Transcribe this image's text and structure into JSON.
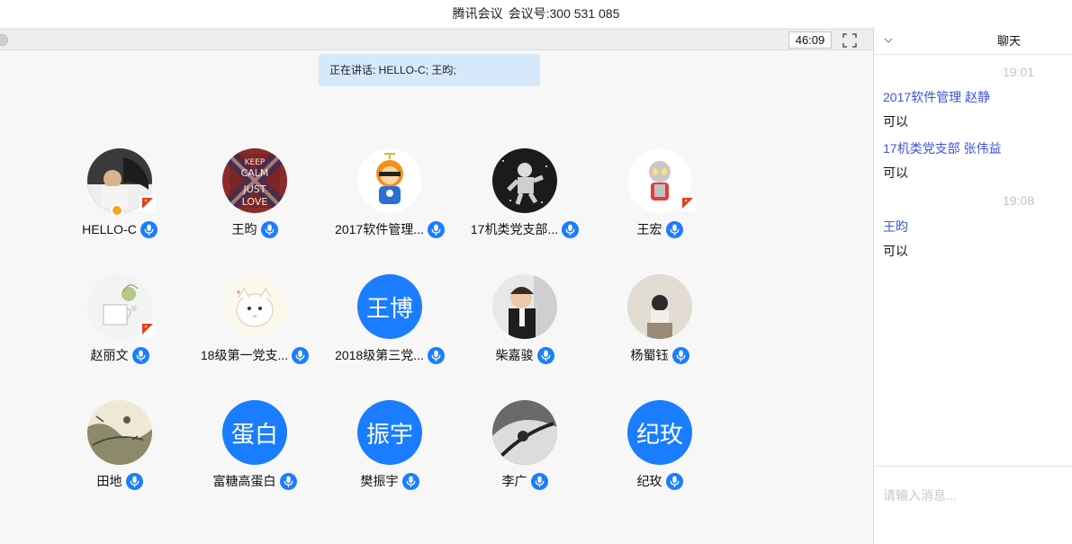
{
  "window": {
    "app_name": "腾讯会议",
    "meeting_id_label": "会议号:",
    "meeting_id": "300 531 085"
  },
  "toolbar": {
    "timer": "46:09",
    "fullscreen_icon": "fullscreen-icon"
  },
  "speaking": {
    "text": "正在讲话: HELLO-C; 王昀;"
  },
  "participants": [
    {
      "name": "HELLO-C",
      "avatar": "photo"
    },
    {
      "name": "王昀",
      "avatar": "photo"
    },
    {
      "name": "2017软件管理...",
      "avatar": "photo"
    },
    {
      "name": "17机类党支部...",
      "avatar": "photo"
    },
    {
      "name": "王宏",
      "avatar": "photo"
    },
    {
      "name": "赵丽文",
      "avatar": "photo"
    },
    {
      "name": "18级第一党支...",
      "avatar": "photo"
    },
    {
      "name": "2018级第三党...",
      "avatar": "text",
      "avatar_text": "王博"
    },
    {
      "name": "柴嘉骏",
      "avatar": "photo"
    },
    {
      "name": "杨蜀钰",
      "avatar": "photo"
    },
    {
      "name": "田地",
      "avatar": "photo"
    },
    {
      "name": "富糖高蛋白",
      "avatar": "text",
      "avatar_text": "蛋白"
    },
    {
      "name": "樊振宇",
      "avatar": "text",
      "avatar_text": "振宇"
    },
    {
      "name": "李广",
      "avatar": "photo"
    },
    {
      "name": "纪玫",
      "avatar": "text",
      "avatar_text": "纪玫"
    }
  ],
  "chat": {
    "title": "聊天",
    "collapse_icon": "chevron-down-icon",
    "messages": [
      {
        "time": "19:01",
        "sender": "2017软件管理 赵静",
        "text": "可以"
      },
      {
        "sender": "17机类党支部 张伟益",
        "text": "可以"
      },
      {
        "time": "19:08",
        "sender": "王昀",
        "text": "可以"
      }
    ],
    "input_placeholder": "请输入消息..."
  },
  "colors": {
    "accent_blue": "#1a7dff",
    "speaking_bg": "#d6e9fb",
    "sender_blue": "#3d55d8",
    "flag_red": "#e8392e",
    "host_badge": "#f5a623"
  }
}
